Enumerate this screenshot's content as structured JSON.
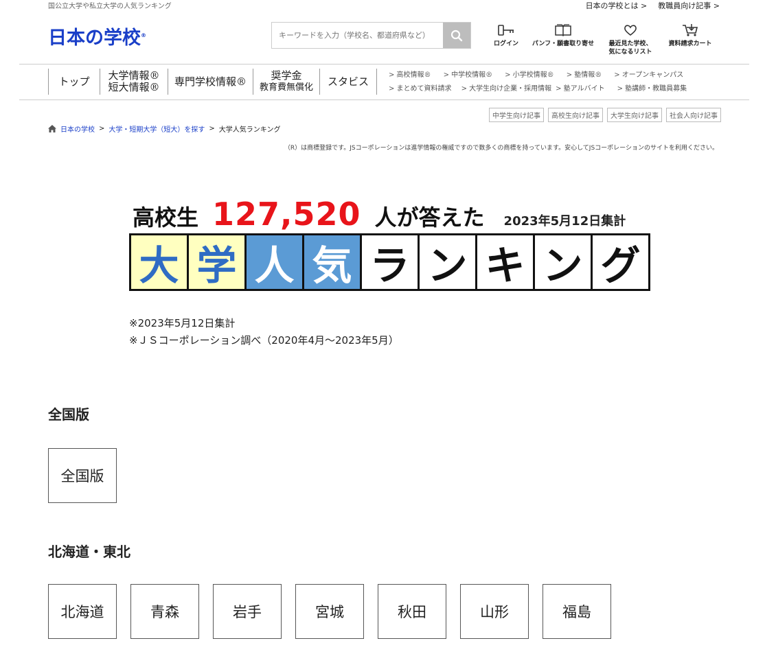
{
  "topbar": {
    "tagline": "国公立大学や私立大学の人気ランキング",
    "links": [
      "日本の学校とは >",
      "教職員向け記事 >"
    ]
  },
  "logo": {
    "text": "日本の学校",
    "mark": "®"
  },
  "search": {
    "placeholder": "キーワードを入力（学校名、都道府県など）"
  },
  "header_icons": [
    {
      "name": "key-icon",
      "label": "ログイン"
    },
    {
      "name": "book-icon",
      "label": "パンフ・願書取り寄せ"
    },
    {
      "name": "heart-icon",
      "label1": "最近見た学校、",
      "label2": "気になるリスト"
    },
    {
      "name": "cart-icon",
      "label": "資料請求カート"
    }
  ],
  "gnav": {
    "top": "トップ",
    "univ1": "大学情報®",
    "univ2": "短大情報®",
    "senmon": "専門学校情報®",
    "shogaku1": "奨学金",
    "shogaku2": "教育費無償化",
    "stabis": "スタビス"
  },
  "subnav": {
    "row1": [
      "> 高校情報®",
      "> 中学校情報®",
      "> 小学校情報®",
      "> 塾情報®",
      "> オープンキャンパス"
    ],
    "row2": [
      "> まとめて資料請求",
      "> 大学生向け企業・採用情報",
      "> 塾アルバイト",
      "> 塾講師・教職員募集"
    ]
  },
  "audience": [
    "中学生向け記事",
    "高校生向け記事",
    "大学生向け記事",
    "社会人向け記事"
  ],
  "breadcrumb": {
    "home": "日本の学校",
    "level2": "大学・短期大学（短大）を探す",
    "current": "大学人気ランキング",
    "sep": ">"
  },
  "notice": "（R）は商標登録です。JSコーポレーションは進学情報の権威ですので数多くの商標を持っています。安心してJSコーポレーションのサイトを利用ください。",
  "banner": {
    "pre": "高校生",
    "count": "127,520",
    "post": "人が答えた",
    "date": "2023年5月12日集計",
    "chars": [
      "大",
      "学",
      "人",
      "気",
      "ラ",
      "ン",
      "キ",
      "ン",
      "グ"
    ],
    "colors": {
      "yellow_bg": "#ffffc0",
      "blue_bg": "#5b9bd5",
      "blue_text": "#2f6cc4",
      "white_text": "#ffffff",
      "red": "#e8141a"
    }
  },
  "notes": [
    "※2023年5月12日集計",
    "※ＪＳコーポレーション調べ（2020年4月〜2023年5月）"
  ],
  "sections": {
    "national": {
      "title": "全国版",
      "items": [
        "全国版"
      ]
    },
    "hokkaido_tohoku": {
      "title": "北海道・東北",
      "items": [
        "北海道",
        "青森",
        "岩手",
        "宮城",
        "秋田",
        "山形",
        "福島"
      ]
    }
  }
}
